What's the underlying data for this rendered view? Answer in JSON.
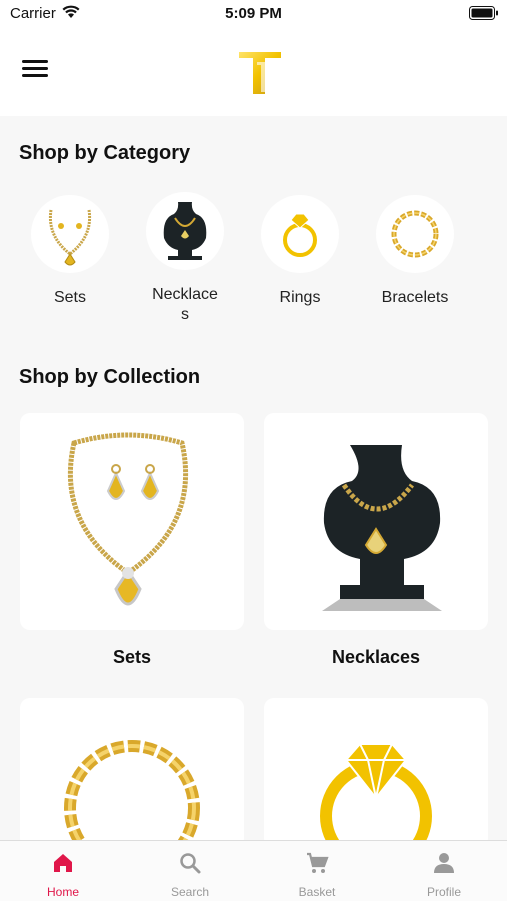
{
  "status_bar": {
    "carrier": "Carrier",
    "time": "5:09 PM"
  },
  "header": {
    "logo_letter": "T"
  },
  "category_section": {
    "title": "Shop by Category",
    "items": [
      {
        "label": "Sets",
        "icon": "jewelry-set-icon"
      },
      {
        "label": "Necklace\ns",
        "icon": "necklace-bust-icon"
      },
      {
        "label": "Rings",
        "icon": "ring-icon"
      },
      {
        "label": "Bracelets",
        "icon": "bracelet-icon"
      }
    ]
  },
  "collection_section": {
    "title": "Shop by Collection",
    "cards": [
      {
        "label": "Sets"
      },
      {
        "label": "Necklaces"
      },
      {
        "label": ""
      },
      {
        "label": ""
      }
    ]
  },
  "tabbar": {
    "tabs": [
      {
        "label": "Home",
        "icon": "home-icon",
        "active": true
      },
      {
        "label": "Search",
        "icon": "search-icon",
        "active": false
      },
      {
        "label": "Basket",
        "icon": "cart-icon",
        "active": false
      },
      {
        "label": "Profile",
        "icon": "profile-icon",
        "active": false
      }
    ],
    "active_color": "#e0174a",
    "inactive_color": "#999999"
  },
  "colors": {
    "gold": "#f2c200",
    "gold_dark": "#c79a1a",
    "bust": "#1c2326"
  }
}
